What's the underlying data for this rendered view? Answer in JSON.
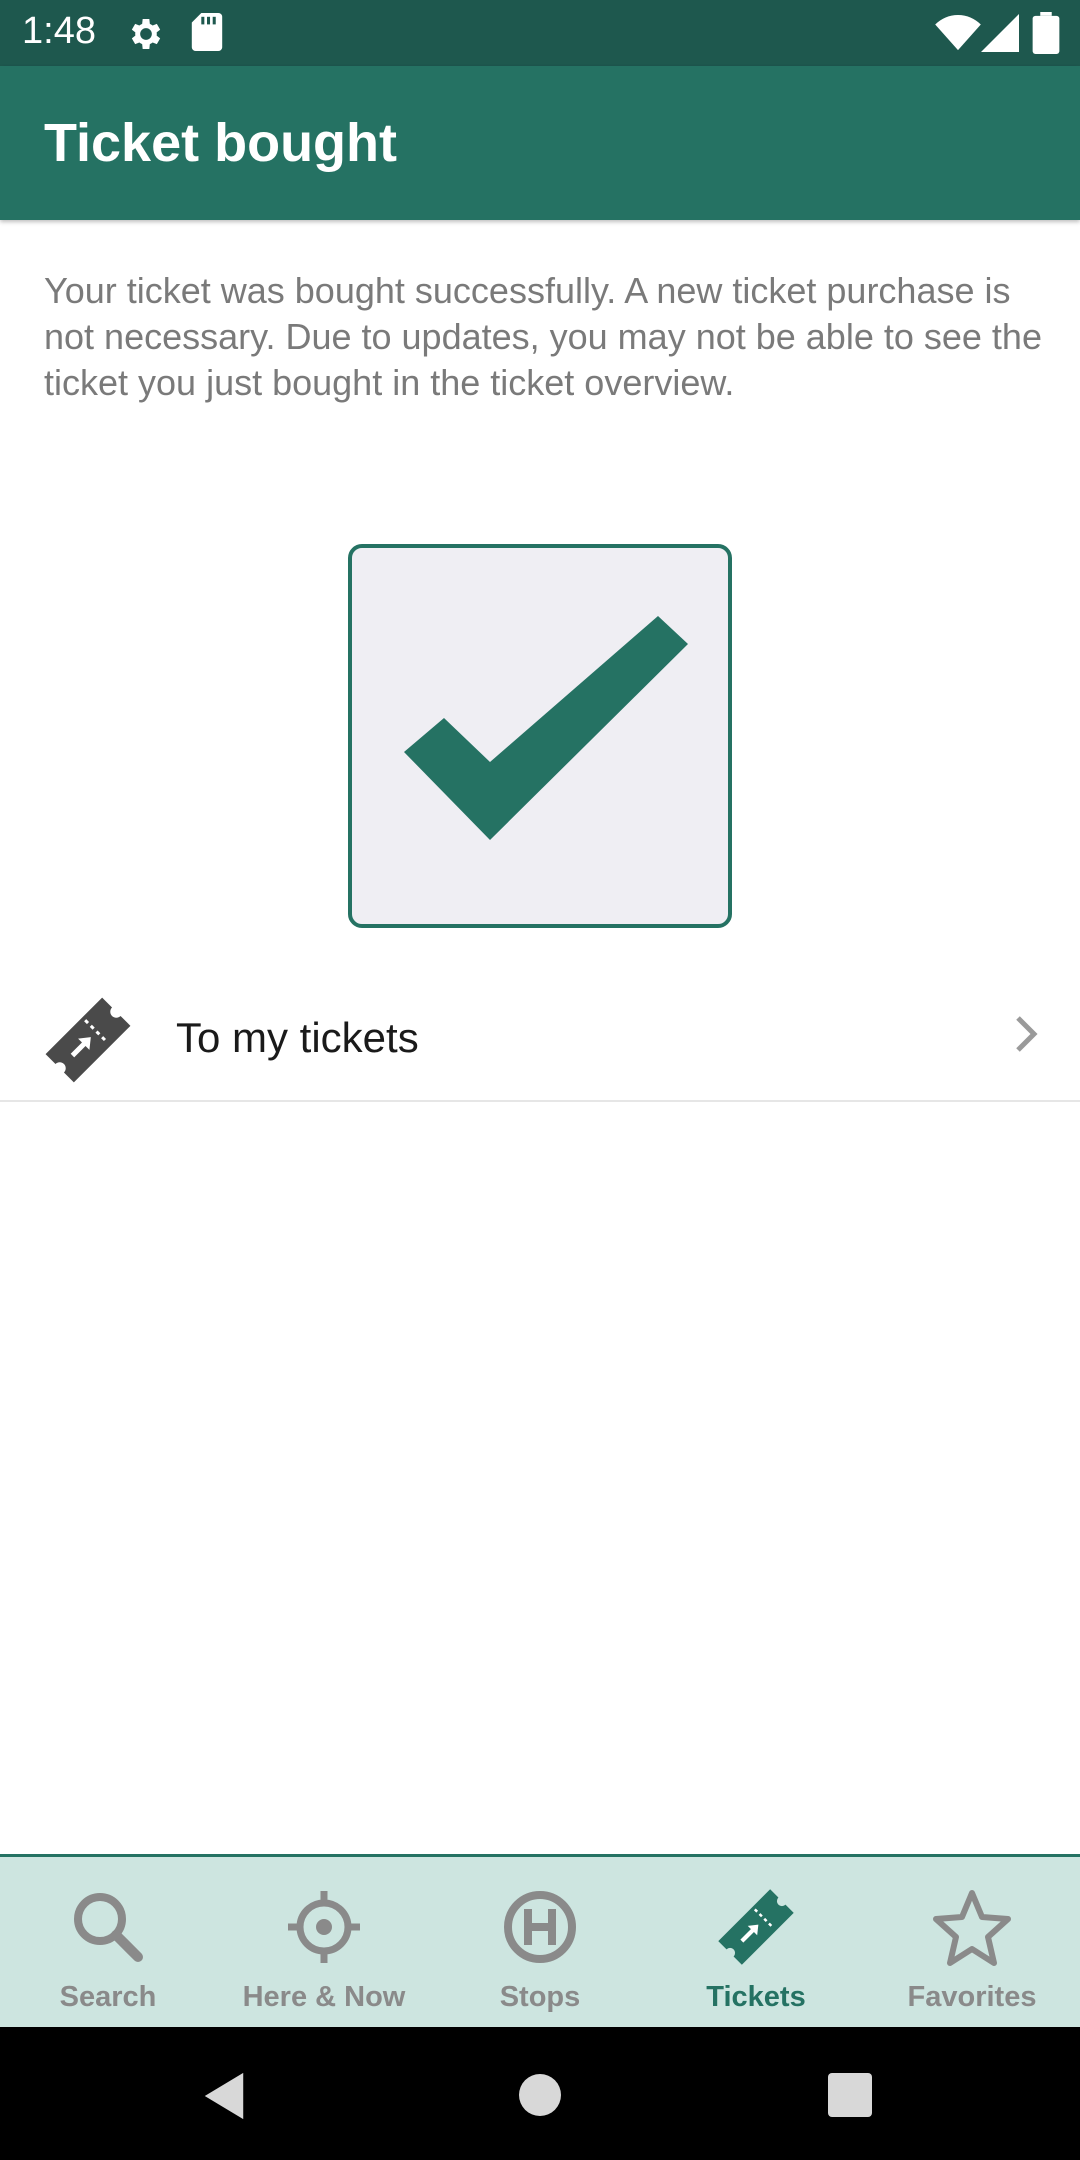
{
  "status_bar": {
    "time": "1:48",
    "icons": [
      "gear-icon",
      "sd-card-icon",
      "wifi-icon",
      "cell-signal-icon",
      "battery-icon"
    ]
  },
  "app_bar": {
    "title": "Ticket bought"
  },
  "main": {
    "message": "Your ticket was bought successfully. A new ticket purchase is not necessary. Due to updates, you may not be able to see the ticket you just bought in the ticket overview.",
    "success_icon": "checkmark-icon",
    "tickets_link": {
      "label": "To my tickets",
      "icon": "ticket-icon",
      "chevron": "chevron-right-icon"
    }
  },
  "bottom_nav": {
    "items": [
      {
        "label": "Search",
        "icon": "search-icon",
        "active": false
      },
      {
        "label": "Here & Now",
        "icon": "crosshair-icon",
        "active": false
      },
      {
        "label": "Stops",
        "icon": "bus-stop-icon",
        "active": false
      },
      {
        "label": "Tickets",
        "icon": "ticket-icon",
        "active": true
      },
      {
        "label": "Favorites",
        "icon": "star-icon",
        "active": false
      }
    ]
  },
  "colors": {
    "primary": "#257263",
    "status_bar": "#1e584e",
    "nav_background": "#cde5e0",
    "inactive": "#8a8a8a",
    "success_box_fill": "#efeef3"
  }
}
